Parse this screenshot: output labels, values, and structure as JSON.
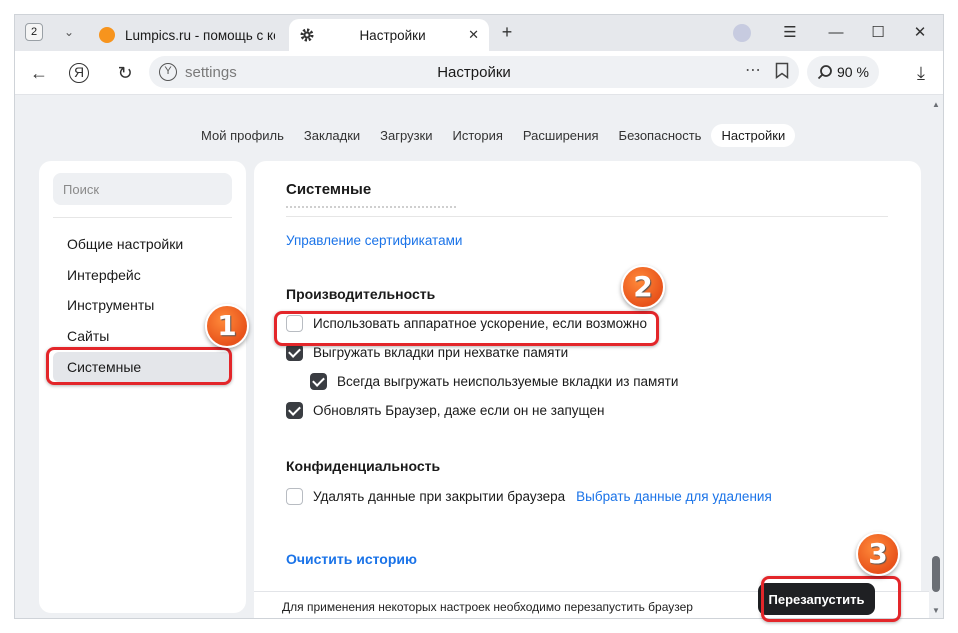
{
  "tabstrip": {
    "tab_count": "2",
    "tab_list_icon": "chevron-down-icon",
    "tabs": [
      {
        "title": "Lumpics.ru - помощь с ко",
        "icon": "orange-favicon"
      },
      {
        "title": "Настройки",
        "icon": "gear-icon"
      }
    ],
    "window_controls": [
      "menu-icon",
      "minimize-icon",
      "maximize-icon",
      "close-icon"
    ]
  },
  "toolbar": {
    "url": "settings",
    "page_title": "Настройки",
    "zoom": "90 %"
  },
  "topnav": {
    "items": [
      "Мой профиль",
      "Закладки",
      "Загрузки",
      "История",
      "Расширения",
      "Безопасность",
      "Настройки"
    ],
    "active": "Настройки"
  },
  "sidebar": {
    "search_placeholder": "Поиск",
    "items": [
      "Общие настройки",
      "Интерфейс",
      "Инструменты",
      "Сайты",
      "Системные"
    ],
    "active": "Системные"
  },
  "main": {
    "section_title": "Системные",
    "certs_link": "Управление сертификатами",
    "performance": {
      "title": "Производительность",
      "options": [
        {
          "label": "Использовать аппаратное ускорение, если возможно",
          "checked": false
        },
        {
          "label": "Выгружать вкладки при нехватке памяти",
          "checked": true
        },
        {
          "label": "Всегда выгружать неиспользуемые вкладки из памяти",
          "checked": true
        },
        {
          "label": "Обновлять Браузер, даже если он не запущен",
          "checked": true
        }
      ]
    },
    "privacy": {
      "title": "Конфиденциальность",
      "option_label": "Удалять данные при закрытии браузера",
      "option_checked": false,
      "option_link": "Выбрать данные для удаления"
    },
    "clear_history": "Очистить историю"
  },
  "bottombar": {
    "message": "Для применения некоторых настроек необходимо перезапустить браузер",
    "restart_label": "Перезапустить"
  },
  "annotations": {
    "badges": [
      "1",
      "2",
      "3"
    ],
    "color": "#e3262a",
    "badge_color": "#e8531b"
  }
}
